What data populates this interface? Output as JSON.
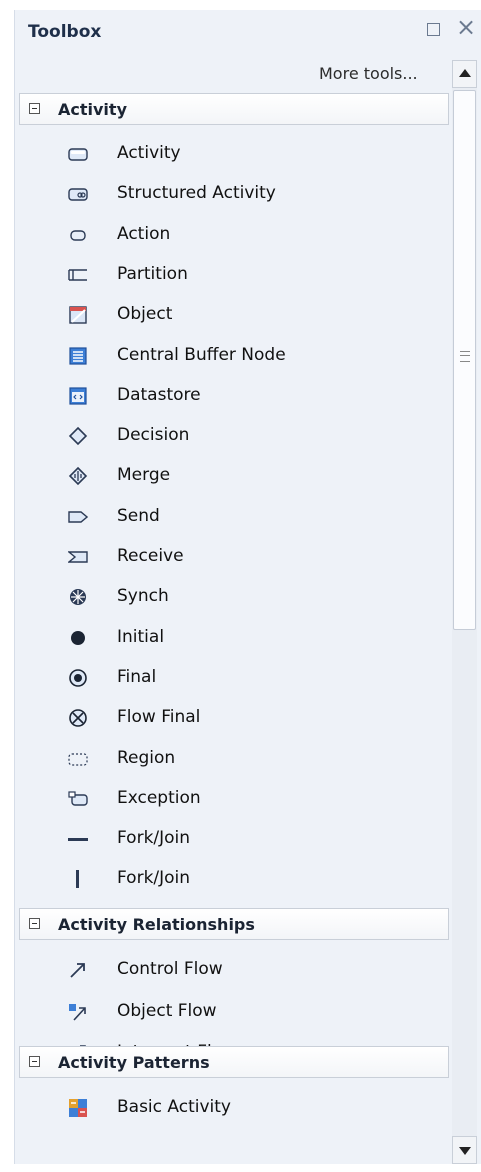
{
  "panel": {
    "title": "Toolbox",
    "more_tools": "More tools...",
    "float_icon": "float-window-icon",
    "close_icon": "close-icon",
    "close_glyph": "×"
  },
  "groups": [
    {
      "title": "Activity",
      "items": [
        {
          "label": "Activity",
          "icon": "activity-icon"
        },
        {
          "label": "Structured Activity",
          "icon": "structured-activity-icon"
        },
        {
          "label": "Action",
          "icon": "action-icon"
        },
        {
          "label": "Partition",
          "icon": "partition-icon"
        },
        {
          "label": "Object",
          "icon": "object-icon"
        },
        {
          "label": "Central Buffer Node",
          "icon": "central-buffer-node-icon"
        },
        {
          "label": "Datastore",
          "icon": "datastore-icon"
        },
        {
          "label": "Decision",
          "icon": "decision-icon"
        },
        {
          "label": "Merge",
          "icon": "merge-icon"
        },
        {
          "label": "Send",
          "icon": "send-icon"
        },
        {
          "label": "Receive",
          "icon": "receive-icon"
        },
        {
          "label": "Synch",
          "icon": "synch-icon"
        },
        {
          "label": "Initial",
          "icon": "initial-icon"
        },
        {
          "label": "Final",
          "icon": "final-icon"
        },
        {
          "label": "Flow Final",
          "icon": "flow-final-icon"
        },
        {
          "label": "Region",
          "icon": "region-icon"
        },
        {
          "label": "Exception",
          "icon": "exception-icon"
        },
        {
          "label": "Fork/Join",
          "icon": "fork-join-horizontal-icon"
        },
        {
          "label": "Fork/Join",
          "icon": "fork-join-vertical-icon"
        }
      ]
    },
    {
      "title": "Activity Relationships",
      "items": [
        {
          "label": "Control Flow",
          "icon": "control-flow-icon"
        },
        {
          "label": "Object Flow",
          "icon": "object-flow-icon"
        },
        {
          "label": "Interrupt Flow",
          "icon": "interrupt-flow-icon"
        }
      ]
    },
    {
      "title": "Activity Patterns",
      "items": [
        {
          "label": "Basic Activity",
          "icon": "basic-activity-icon"
        }
      ]
    }
  ]
}
